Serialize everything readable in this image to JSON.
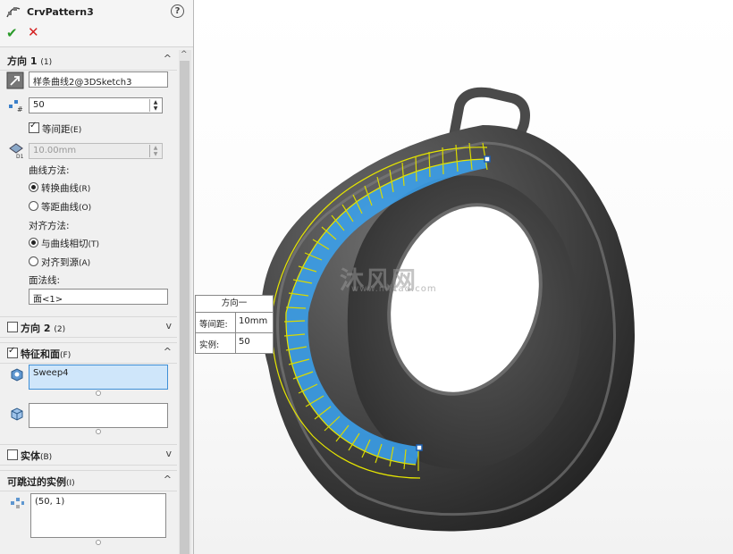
{
  "header": {
    "title": "CrvPattern3",
    "help_label": "?",
    "ok_label": "✔",
    "cancel_label": "✕"
  },
  "direction1": {
    "label": "方向 1",
    "shortcut": "(1)",
    "curve_value": "样条曲线2@3DSketch3",
    "instances_value": "50",
    "equal_spacing_label": "等间距",
    "equal_spacing_shortcut": "(E)",
    "spacing_value": "10.00mm",
    "curve_method_label": "曲线方法:",
    "transform_curve_label": "转换曲线",
    "transform_curve_shortcut": "(R)",
    "offset_curve_label": "等距曲线",
    "offset_curve_shortcut": "(O)",
    "alignment_label": "对齐方法:",
    "tangent_label": "与曲线相切",
    "tangent_shortcut": "(T)",
    "align_origin_label": "对齐到源",
    "align_origin_shortcut": "(A)",
    "face_normal_label": "面法线:",
    "face_value": "面<1>"
  },
  "direction2": {
    "label": "方向 2",
    "shortcut": "(2)"
  },
  "features": {
    "label": "特征和面",
    "shortcut": "(F)",
    "item": "Sweep4"
  },
  "bodies": {
    "label": "实体",
    "shortcut": "(B)"
  },
  "skip": {
    "label": "可跳过的实例",
    "shortcut": "(I)",
    "item": "(50, 1)"
  },
  "callout": {
    "title": "方向一",
    "spacing_key": "等间距:",
    "spacing_value": "10mm",
    "instances_key": "实例:",
    "instances_value": "50"
  },
  "watermark": {
    "text": "沐风网",
    "url": "www.mfcad.com"
  },
  "colors": {
    "accent": "#3f8fd6",
    "sweep_blue": "#39a3f2",
    "pattern_yellow": "#e6e600",
    "model_gray": "#3e3e3e"
  }
}
